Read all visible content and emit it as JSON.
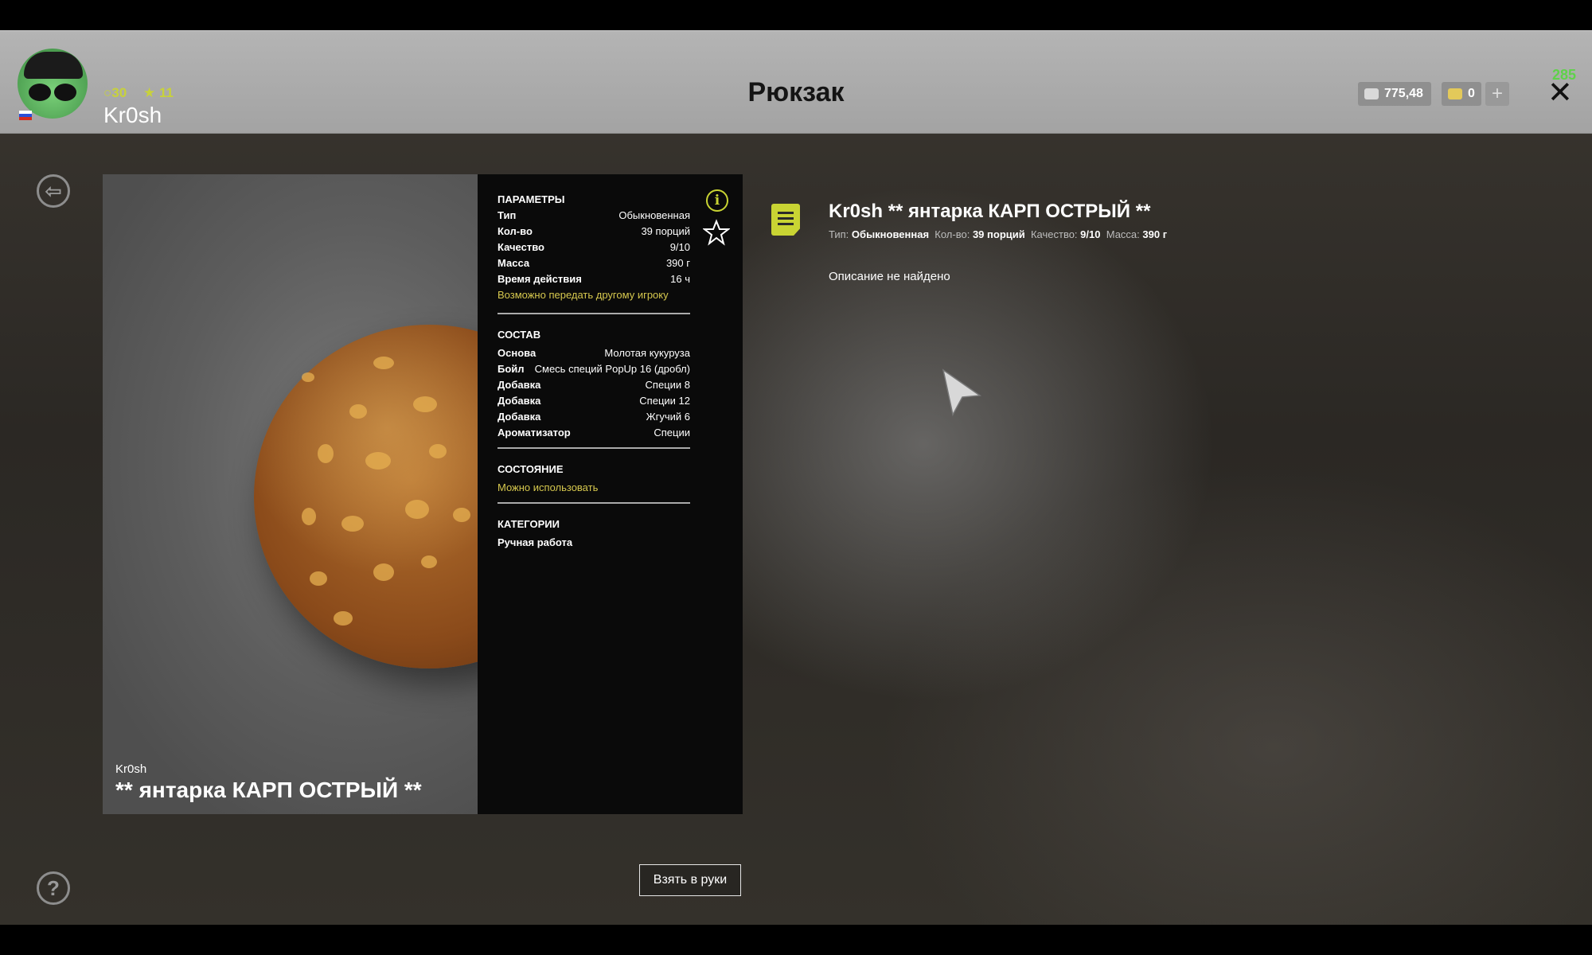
{
  "header": {
    "title": "Рюкзак",
    "player": {
      "name": "Kr0sh",
      "level": "30",
      "stars": "11"
    },
    "currency_silver": "775,48",
    "currency_gold": "0",
    "add_label": "+",
    "close_label": "✕",
    "fps": "285"
  },
  "item": {
    "owner": "Kr0sh",
    "name": "** янтарка КАРП ОСТРЫЙ **",
    "full_title": "Kr0sh ** янтарка КАРП ОСТРЫЙ **",
    "params_title": "ПАРАМЕТРЫ",
    "params": [
      {
        "label": "Тип",
        "value": "Обыкновенная"
      },
      {
        "label": "Кол-во",
        "value": "39 порций"
      },
      {
        "label": "Качество",
        "value": "9/10"
      },
      {
        "label": "Масса",
        "value": "390 г"
      },
      {
        "label": "Время действия",
        "value": "16 ч"
      }
    ],
    "transferable": "Возможно передать другому игроку",
    "composition_title": "СОСТАВ",
    "composition": [
      {
        "label": "Основа",
        "value": "Молотая кукуруза"
      },
      {
        "label": "Бойл",
        "value": "Смесь специй PopUp 16 (дробл)"
      },
      {
        "label": "Добавка",
        "value": "Специи 8"
      },
      {
        "label": "Добавка",
        "value": "Специи 12"
      },
      {
        "label": "Добавка",
        "value": "Жгучий 6"
      },
      {
        "label": "Ароматизатор",
        "value": "Специи"
      }
    ],
    "state_title": "СОСТОЯНИЕ",
    "state": "Можно использовать",
    "categories_title": "КАТЕГОРИИ",
    "category": "Ручная работа",
    "meta": {
      "type_label": "Тип:",
      "type_value": "Обыкновенная",
      "qty_label": "Кол-во:",
      "qty_value": "39 порций",
      "quality_label": "Качество:",
      "quality_value": "9/10",
      "mass_label": "Масса:",
      "mass_value": "390 г"
    },
    "description": "Описание не найдено"
  },
  "actions": {
    "take_label": "Взять в руки"
  },
  "icons": {
    "back": "back-icon",
    "help": "help-icon",
    "info": "info-icon",
    "favorite": "star-icon",
    "document": "document-icon",
    "cursor": "cursor-icon"
  },
  "colors": {
    "accent": "#c9d433",
    "highlight_text": "#d6c84e",
    "header_bg": "#b0b0b0",
    "panel_bg": "#0a0a0a"
  }
}
